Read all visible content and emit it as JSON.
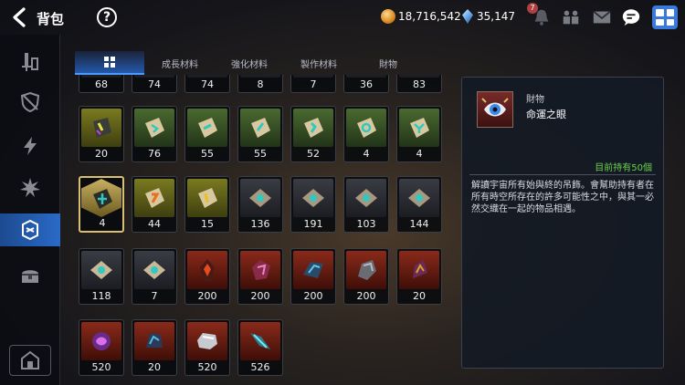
{
  "header": {
    "title": "背包",
    "help_label": "?",
    "gold": "18,716,542",
    "gems": "35,147",
    "bell_badge": "7"
  },
  "sidebar": {
    "items": [
      "equipment-icon",
      "armor-icon",
      "skill-icon",
      "rune-icon",
      "material-icon",
      "chest-icon"
    ],
    "active_index": 4,
    "bottom": "shop-icon"
  },
  "tabs": {
    "all_icon": "grid-icon",
    "labels": [
      "成長材料",
      "強化材料",
      "製作材料",
      "財物"
    ]
  },
  "rows": [
    {
      "counts": [
        "68",
        "74",
        "74",
        "8",
        "7",
        "36",
        "83"
      ]
    },
    {
      "counts": [
        "20",
        "76",
        "55",
        "55",
        "52",
        "4",
        "4"
      ]
    },
    {
      "counts": [
        "4",
        "44",
        "15",
        "136",
        "191",
        "103",
        "144"
      ]
    },
    {
      "counts": [
        "118",
        "7",
        "200",
        "200",
        "200",
        "200",
        "20"
      ]
    },
    {
      "counts": [
        "520",
        "20",
        "520",
        "526"
      ]
    }
  ],
  "detail": {
    "category": "財物",
    "name": "命運之眼",
    "owned": "目前持有50個",
    "description": "解讀宇宙所有始與終的吊飾。會幫助持有者在所有時空所存在的許多可能性之中，與其一必然交織在一起的物品相遇。"
  },
  "colors": {
    "accent": "#2a6ac8",
    "owned_green": "#6ad04a",
    "selected_border": "#d8c070"
  }
}
